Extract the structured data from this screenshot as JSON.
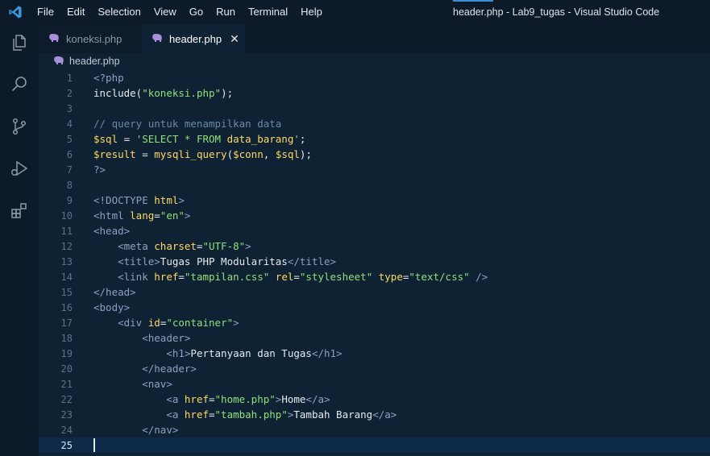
{
  "menu": {
    "items": [
      "File",
      "Edit",
      "Selection",
      "View",
      "Go",
      "Run",
      "Terminal",
      "Help"
    ],
    "window_title": "header.php - Lab9_tugas - Visual Studio Code"
  },
  "tabs": [
    {
      "label": "koneksi.php",
      "active": false
    },
    {
      "label": "header.php",
      "active": true,
      "close": "✕"
    }
  ],
  "breadcrumb": {
    "file": "header.php"
  },
  "colors": {
    "accent": "#3b8fd6",
    "php_icon": "#a98fd9",
    "string": "#93e07a",
    "attribute": "#ffd866",
    "tag": "#8aa1c2",
    "comment": "#6c88a8",
    "background": "#0f2233"
  },
  "icons": {
    "activity": [
      "explorer-icon",
      "search-icon",
      "source-control-icon",
      "run-debug-icon",
      "extensions-icon"
    ]
  },
  "editor": {
    "current_line": 25,
    "lines": [
      {
        "n": "1",
        "tokens": [
          [
            "t-tag",
            "<?php"
          ]
        ]
      },
      {
        "n": "2",
        "tokens": [
          [
            "t-plain",
            "include("
          ],
          [
            "t-str",
            "\"koneksi.php\""
          ],
          [
            "t-plain",
            ");"
          ]
        ]
      },
      {
        "n": "3",
        "tokens": []
      },
      {
        "n": "4",
        "tokens": [
          [
            "t-com",
            "// query untuk menampilkan data"
          ]
        ]
      },
      {
        "n": "5",
        "tokens": [
          [
            "t-var",
            "$sql"
          ],
          [
            "t-plain",
            " = "
          ],
          [
            "t-str",
            "'SELECT * FROM "
          ],
          [
            "t-var",
            "data_barang"
          ],
          [
            "t-str",
            "'"
          ],
          [
            "t-plain",
            ";"
          ]
        ]
      },
      {
        "n": "6",
        "tokens": [
          [
            "t-var",
            "$result"
          ],
          [
            "t-plain",
            " = "
          ],
          [
            "t-fn",
            "mysqli_query"
          ],
          [
            "t-plain",
            "("
          ],
          [
            "t-var",
            "$conn"
          ],
          [
            "t-plain",
            ", "
          ],
          [
            "t-var",
            "$sql"
          ],
          [
            "t-plain",
            ");"
          ]
        ]
      },
      {
        "n": "7",
        "tokens": [
          [
            "t-tag",
            "?>"
          ]
        ]
      },
      {
        "n": "8",
        "tokens": []
      },
      {
        "n": "9",
        "tokens": [
          [
            "t-tag",
            "<!DOCTYPE "
          ],
          [
            "t-attr",
            "html"
          ],
          [
            "t-tag",
            ">"
          ]
        ]
      },
      {
        "n": "10",
        "tokens": [
          [
            "t-tag",
            "<html "
          ],
          [
            "t-attr",
            "lang"
          ],
          [
            "t-plain",
            "="
          ],
          [
            "t-str",
            "\"en\""
          ],
          [
            "t-tag",
            ">"
          ]
        ]
      },
      {
        "n": "11",
        "tokens": [
          [
            "t-tag",
            "<head>"
          ]
        ]
      },
      {
        "n": "12",
        "tokens": [
          [
            "t-plain",
            "    "
          ],
          [
            "t-tag",
            "<meta "
          ],
          [
            "t-attr",
            "charset"
          ],
          [
            "t-plain",
            "="
          ],
          [
            "t-str",
            "\"UTF-8\""
          ],
          [
            "t-tag",
            ">"
          ]
        ]
      },
      {
        "n": "13",
        "tokens": [
          [
            "t-plain",
            "    "
          ],
          [
            "t-tag",
            "<title>"
          ],
          [
            "t-plain",
            "Tugas PHP Modularitas"
          ],
          [
            "t-tag",
            "</title>"
          ]
        ]
      },
      {
        "n": "14",
        "tokens": [
          [
            "t-plain",
            "    "
          ],
          [
            "t-tag",
            "<link "
          ],
          [
            "t-attr",
            "href"
          ],
          [
            "t-plain",
            "="
          ],
          [
            "t-str",
            "\"tampilan.css\""
          ],
          [
            "t-plain",
            " "
          ],
          [
            "t-attr",
            "rel"
          ],
          [
            "t-plain",
            "="
          ],
          [
            "t-str",
            "\"stylesheet\""
          ],
          [
            "t-plain",
            " "
          ],
          [
            "t-attr",
            "type"
          ],
          [
            "t-plain",
            "="
          ],
          [
            "t-str",
            "\"text/css\""
          ],
          [
            "t-plain",
            " "
          ],
          [
            "t-tag",
            "/>"
          ]
        ]
      },
      {
        "n": "15",
        "tokens": [
          [
            "t-tag",
            "</head>"
          ]
        ]
      },
      {
        "n": "16",
        "tokens": [
          [
            "t-tag",
            "<body>"
          ]
        ]
      },
      {
        "n": "17",
        "tokens": [
          [
            "t-plain",
            "    "
          ],
          [
            "t-tag",
            "<div "
          ],
          [
            "t-attr",
            "id"
          ],
          [
            "t-plain",
            "="
          ],
          [
            "t-str",
            "\"container\""
          ],
          [
            "t-tag",
            ">"
          ]
        ]
      },
      {
        "n": "18",
        "tokens": [
          [
            "t-plain",
            "        "
          ],
          [
            "t-tag",
            "<header>"
          ]
        ]
      },
      {
        "n": "19",
        "tokens": [
          [
            "t-plain",
            "            "
          ],
          [
            "t-tag",
            "<h1>"
          ],
          [
            "t-plain",
            "Pertanyaan dan Tugas"
          ],
          [
            "t-tag",
            "</h1>"
          ]
        ]
      },
      {
        "n": "20",
        "tokens": [
          [
            "t-plain",
            "        "
          ],
          [
            "t-tag",
            "</header>"
          ]
        ]
      },
      {
        "n": "21",
        "tokens": [
          [
            "t-plain",
            "        "
          ],
          [
            "t-tag",
            "<nav>"
          ]
        ]
      },
      {
        "n": "22",
        "tokens": [
          [
            "t-plain",
            "            "
          ],
          [
            "t-tag",
            "<a "
          ],
          [
            "t-attr",
            "href"
          ],
          [
            "t-plain",
            "="
          ],
          [
            "t-str",
            "\"home.php\""
          ],
          [
            "t-tag",
            ">"
          ],
          [
            "t-plain",
            "Home"
          ],
          [
            "t-tag",
            "</a>"
          ]
        ]
      },
      {
        "n": "23",
        "tokens": [
          [
            "t-plain",
            "            "
          ],
          [
            "t-tag",
            "<a "
          ],
          [
            "t-attr",
            "href"
          ],
          [
            "t-plain",
            "="
          ],
          [
            "t-str",
            "\"tambah.php\""
          ],
          [
            "t-tag",
            ">"
          ],
          [
            "t-plain",
            "Tambah Barang"
          ],
          [
            "t-tag",
            "</a>"
          ]
        ]
      },
      {
        "n": "24",
        "tokens": [
          [
            "t-plain",
            "        "
          ],
          [
            "t-tag",
            "</nav>"
          ]
        ]
      },
      {
        "n": "25",
        "tokens": []
      }
    ]
  }
}
